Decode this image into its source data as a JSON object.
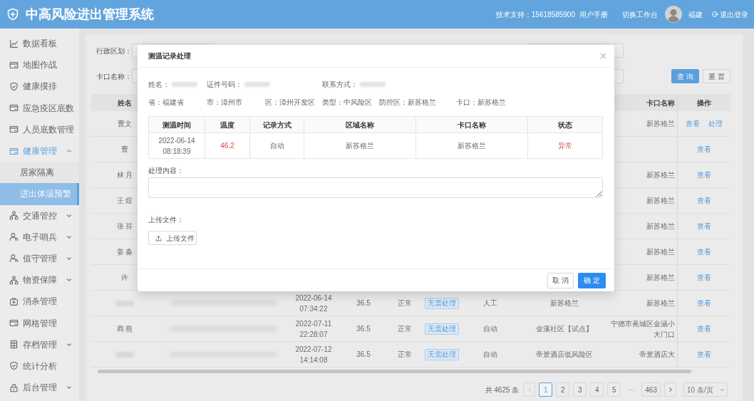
{
  "header": {
    "title": "中高风险进出管理系统",
    "support": "技术支持：15618585900",
    "links": [
      "用户手册",
      "切换工作台"
    ],
    "user": "福建",
    "logout": "退出登录"
  },
  "sidebar": {
    "items": [
      {
        "label": "数据看板",
        "selected": false
      },
      {
        "label": "地图作战",
        "selected": false
      },
      {
        "label": "健康摸排",
        "selected": false
      },
      {
        "label": "应急疫区底数",
        "selected": false
      },
      {
        "label": "人员底数管理",
        "selected": false
      },
      {
        "label": "健康管理",
        "selected": false,
        "expanded": true,
        "children": [
          {
            "label": "居家隔离",
            "selected": false
          },
          {
            "label": "进出体温预警",
            "selected": true
          }
        ]
      },
      {
        "label": "交通管控",
        "selected": false,
        "expanded": false
      },
      {
        "label": "电子哨兵",
        "selected": false,
        "expanded": false
      },
      {
        "label": "值守管理",
        "selected": false,
        "expanded": false
      },
      {
        "label": "物资保障",
        "selected": false,
        "expanded": false
      },
      {
        "label": "消杀管理",
        "selected": false
      },
      {
        "label": "网格管理",
        "selected": false
      },
      {
        "label": "存档管理",
        "selected": false,
        "expanded": false
      },
      {
        "label": "统计分析",
        "selected": false
      },
      {
        "label": "后台管理",
        "selected": false,
        "expanded": false
      }
    ]
  },
  "filters": [
    {
      "label": "行政区划："
    },
    {
      "label": "卡口名称：",
      "buttons": [
        {
          "label": "查 询",
          "kind": "primary"
        },
        {
          "label": "重 置",
          "kind": "default"
        }
      ]
    }
  ],
  "table": {
    "columns": [
      "姓名",
      "卡口名称",
      "操作"
    ],
    "rows": [
      {
        "name": "曹文",
        "checkpoint": [
          "新苏格兰"
        ],
        "actions": [
          "查看",
          "处理"
        ]
      },
      {
        "name": "曹",
        "actions": [
          "查看"
        ]
      },
      {
        "name": "林 月",
        "checkpoint": [
          "新苏格兰"
        ],
        "actions": [
          "查看"
        ]
      },
      {
        "name": "王 煜",
        "checkpoint": [
          "新苏格兰"
        ],
        "actions": [
          "查看"
        ]
      },
      {
        "name": "张 芬",
        "checkpoint": [
          "新苏格兰"
        ],
        "actions": [
          "查看"
        ]
      },
      {
        "name": "姜 淼",
        "checkpoint": [
          "新苏格兰"
        ],
        "actions": [
          "查看"
        ]
      },
      {
        "name": "许",
        "checkpoint": [
          "新苏格兰"
        ],
        "actions": [
          "查看"
        ]
      },
      {
        "name_redacted": true,
        "id_redacted": true,
        "time": [
          "2022-06-14",
          "07:34:22"
        ],
        "temperature": "36.5",
        "status": "正常",
        "abnormal": false,
        "handling": "无需处理",
        "method": "人工",
        "area": "新苏格兰",
        "checkpoint": [
          "新苏格兰"
        ],
        "actions": [
          "查看"
        ]
      },
      {
        "name": "商 燕",
        "id_redacted": true,
        "time": [
          "2022-07-11",
          "22:28:07"
        ],
        "temperature": "36.5",
        "status": "正常",
        "abnormal": false,
        "handling": "无需处理",
        "method": "自动",
        "area": "金溪社区【试点】",
        "checkpoint": [
          "宁德市蕉城区金涵小",
          "大门口"
        ],
        "actions": [
          "查看"
        ]
      },
      {
        "name_redacted": true,
        "id_redacted": true,
        "time": [
          "2022-07-12",
          "14:14:08"
        ],
        "temperature": "36.5",
        "status": "正常",
        "abnormal": false,
        "handling": "无需处理",
        "method": "自动",
        "area": "帝景酒店低风险区",
        "checkpoint": [
          "帝景酒店大"
        ],
        "actions": [
          "查看"
        ]
      }
    ]
  },
  "pagination": {
    "total": "共 4625 条",
    "prev_disabled": true,
    "next_disabled": false,
    "pages": [
      {
        "label": "1",
        "kind": "page",
        "selected": true
      },
      {
        "label": "2",
        "kind": "page",
        "selected": false
      },
      {
        "label": "3",
        "kind": "page",
        "selected": false
      },
      {
        "label": "4",
        "kind": "page",
        "selected": false
      },
      {
        "label": "5",
        "kind": "page",
        "selected": false
      },
      {
        "label": "···",
        "kind": "ellipsis",
        "selected": false
      },
      {
        "label": "463",
        "kind": "page",
        "selected": false
      }
    ],
    "page_size": "10 条/页"
  },
  "modal": {
    "title": "测温记录处理",
    "info_rows": [
      [
        {
          "text": "姓名：",
          "redacted": true
        },
        {
          "text": "证件号码：",
          "redacted": true
        },
        {
          "text": "联系方式：",
          "redacted": true
        }
      ],
      [
        {
          "text": "省：福建省"
        },
        {
          "text": "市：漳州市"
        },
        {
          "text": "区：漳州开发区"
        },
        {
          "text": "类型：中风险区"
        },
        {
          "text": "防控区：新苏格兰"
        },
        {
          "text": "卡口：新苏格兰"
        }
      ]
    ],
    "record_table": {
      "columns": [
        "测温时间",
        "温度",
        "记录方式",
        "区域名称",
        "卡口名称",
        "状态"
      ],
      "rows": [
        {
          "time": [
            "2022-06-14",
            "08:18:39"
          ],
          "temperature": "46.2",
          "method": "自动",
          "area": "新苏格兰",
          "checkpoint": "新苏格兰",
          "status": "异常",
          "abnormal": true
        }
      ]
    },
    "content_label": "处理内容：",
    "upload_label": "上传文件：",
    "upload_button": "上传文件",
    "buttons": [
      {
        "label": "取 消",
        "kind": "default"
      },
      {
        "label": "确 定",
        "kind": "primary"
      }
    ]
  }
}
